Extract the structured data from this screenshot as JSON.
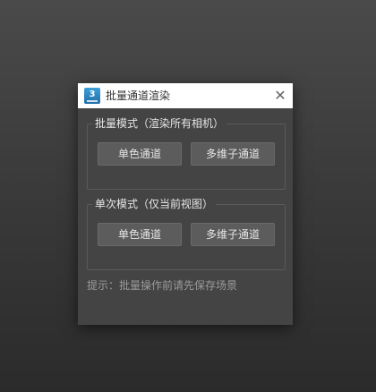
{
  "window": {
    "title": "批量通道渲染",
    "app_icon_label": "3",
    "close_glyph": "✕"
  },
  "batch_mode": {
    "title": "批量模式（渲染所有相机）",
    "single_channel_label": "单色通道",
    "multi_channel_label": "多维子通道"
  },
  "single_mode": {
    "title": "单次模式（仅当前视图）",
    "single_channel_label": "单色通道",
    "multi_channel_label": "多维子通道"
  },
  "hint": {
    "text": "提示：批量操作前请先保存场景"
  },
  "icons": {
    "app": "app-3ds-icon",
    "close": "close-icon"
  }
}
